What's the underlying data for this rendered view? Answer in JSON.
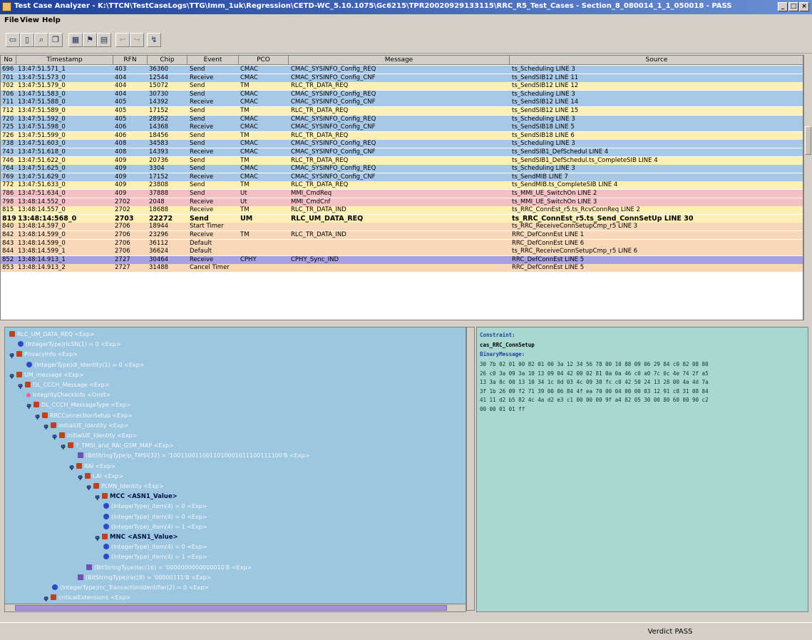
{
  "window": {
    "title": "Test Case Analyzer - K:\\TTCN\\TestCaseLogs\\TTG\\Imm_1uk\\Regression\\CETD-WC_5.10.1075\\Gc6215\\TPR20020929133115\\RRC_R5_Test_Cases - Section_8_080014_1_1_050018 - PASS"
  },
  "menu": [
    {
      "label": "File"
    },
    {
      "label": "View"
    },
    {
      "label": "Help"
    }
  ],
  "toolbar": [
    {
      "icon": "open-icon",
      "glyph": "▭"
    },
    {
      "icon": "new-icon",
      "glyph": "▯"
    },
    {
      "icon": "find-icon",
      "glyph": "⌕"
    },
    {
      "icon": "copy-icon",
      "glyph": "❐"
    },
    {
      "icon": "filter-icon",
      "glyph": "▦"
    },
    {
      "icon": "mark-icon",
      "glyph": "⚑"
    },
    {
      "icon": "step-icon",
      "glyph": "▤"
    },
    {
      "icon": "back-icon",
      "glyph": "↩"
    },
    {
      "icon": "forward-icon",
      "glyph": "↪"
    },
    {
      "icon": "run-icon",
      "glyph": "↯"
    }
  ],
  "grid": {
    "columns": [
      "No",
      "Timestamp",
      "RFN",
      "Chip",
      "Event",
      "PCO",
      "Message",
      "Source"
    ],
    "colors": {
      "blue": "#a8c8e8",
      "yellow": "#fcf0b4",
      "pink": "#f4c0c4",
      "orange": "#f8d8b8",
      "selected": "#a8a0e0"
    },
    "rows": [
      {
        "no": "696",
        "ts": "13:47:51.571_1",
        "rfn": "403",
        "chip": "36360",
        "event": "Send",
        "pco": "CMAC",
        "msg": "CMAC_SYSINFO_Config_REQ",
        "src": "ts_Scheduling LINE 3",
        "color": "blue"
      },
      {
        "no": "701",
        "ts": "13:47:51.573_0",
        "rfn": "404",
        "chip": "12544",
        "event": "Receive",
        "pco": "CMAC",
        "msg": "CMAC_SYSINFO_Config_CNF",
        "src": "ts_SendSIB12 LINE 11",
        "color": "blue"
      },
      {
        "no": "702",
        "ts": "13:47:51.579_0",
        "rfn": "404",
        "chip": "15072",
        "event": "Send",
        "pco": "TM",
        "msg": "RLC_TR_DATA_REQ",
        "src": "ts_SendSIB12 LINE 12",
        "color": "yellow"
      },
      {
        "no": "706",
        "ts": "13:47:51.583_0",
        "rfn": "404",
        "chip": "30730",
        "event": "Send",
        "pco": "CMAC",
        "msg": "CMAC_SYSINFO_Config_REQ",
        "src": "ts_Scheduling LINE 3",
        "color": "blue"
      },
      {
        "no": "711",
        "ts": "13:47:51.588_0",
        "rfn": "405",
        "chip": "14392",
        "event": "Receive",
        "pco": "CMAC",
        "msg": "CMAC_SYSINFO_Config_CNF",
        "src": "ts_SendSIB12 LINE 14",
        "color": "blue"
      },
      {
        "no": "712",
        "ts": "13:47:51.589_0",
        "rfn": "405",
        "chip": "17152",
        "event": "Send",
        "pco": "TM",
        "msg": "RLC_TR_DATA_REQ",
        "src": "ts_SendSIB12 LINE 15",
        "color": "yellow"
      },
      {
        "no": "720",
        "ts": "13:47:51.592_0",
        "rfn": "405",
        "chip": "28952",
        "event": "Send",
        "pco": "CMAC",
        "msg": "CMAC_SYSINFO_Config_REQ",
        "src": "ts_Scheduling LINE 3",
        "color": "blue"
      },
      {
        "no": "725",
        "ts": "13:47:51.598_0",
        "rfn": "406",
        "chip": "14368",
        "event": "Receive",
        "pco": "CMAC",
        "msg": "CMAC_SYSINFO_Config_CNF",
        "src": "ts_SendSIB18 LINE 5",
        "color": "blue"
      },
      {
        "no": "726",
        "ts": "13:47:51.599_0",
        "rfn": "406",
        "chip": "18456",
        "event": "Send",
        "pco": "TM",
        "msg": "RLC_TR_DATA_REQ",
        "src": "ts_SendSIB18 LINE 6",
        "color": "yellow"
      },
      {
        "no": "738",
        "ts": "13:47:51.603_0",
        "rfn": "408",
        "chip": "34583",
        "event": "Send",
        "pco": "CMAC",
        "msg": "CMAC_SYSINFO_Config_REQ",
        "src": "ts_Scheduling LINE 3",
        "color": "blue"
      },
      {
        "no": "743",
        "ts": "13:47:51.618_0",
        "rfn": "408",
        "chip": "14393",
        "event": "Receive",
        "pco": "CMAC",
        "msg": "CMAC_SYSINFO_Config_CNF",
        "src": "ts_SendSIB1_DefSchedul LINE 4",
        "color": "blue"
      },
      {
        "no": "746",
        "ts": "13:47:51.622_0",
        "rfn": "409",
        "chip": "20736",
        "event": "Send",
        "pco": "TM",
        "msg": "RLC_TR_DATA_REQ",
        "src": "ts_SendSIB1_DefSchedul.ts_CompleteSIB LINE 4",
        "color": "yellow"
      },
      {
        "no": "764",
        "ts": "13:47:51.625_0",
        "rfn": "409",
        "chip": "3304",
        "event": "Send",
        "pco": "CMAC",
        "msg": "CMAC_SYSINFO_Config_REQ",
        "src": "ts_Scheduling LINE 3",
        "color": "blue"
      },
      {
        "no": "769",
        "ts": "13:47:51.629_0",
        "rfn": "409",
        "chip": "17152",
        "event": "Receive",
        "pco": "CMAC",
        "msg": "CMAC_SYSINFO_Config_CNF",
        "src": "ts_SendMIB LINE 7",
        "color": "blue"
      },
      {
        "no": "772",
        "ts": "13:47:51.633_0",
        "rfn": "409",
        "chip": "23808",
        "event": "Send",
        "pco": "TM",
        "msg": "RLC_TR_DATA_REQ",
        "src": "ts_SendMIB.ts_CompleteSIB LINE 4",
        "color": "yellow"
      },
      {
        "no": "786",
        "ts": "13:47:51.634_0",
        "rfn": "409",
        "chip": "37888",
        "event": "Send",
        "pco": "Ut",
        "msg": "MMI_CmdReq",
        "src": "ts_MMI_UE_SwitchOn LINE 2",
        "color": "pink"
      },
      {
        "no": "798",
        "ts": "13:48:14.552_0",
        "rfn": "2702",
        "chip": "2048",
        "event": "Receive",
        "pco": "Ut",
        "msg": "MMI_CmdCnf",
        "src": "ts_MMI_UE_SwitchOn LINE 3",
        "color": "pink"
      },
      {
        "no": "815",
        "ts": "13:48:14.557_0",
        "rfn": "2702",
        "chip": "18688",
        "event": "Receive",
        "pco": "TM",
        "msg": "RLC_TR_DATA_IND",
        "src": "ts_RRC_ConnEst_r5.ts_RcvConnReq LINE 2",
        "color": "yellow"
      },
      {
        "no": "819",
        "ts": "13:48:14:568_0",
        "rfn": "2703",
        "chip": "22272",
        "event": "Send",
        "pco": "UM",
        "msg": "RLC_UM_DATA_REQ",
        "src": "ts_RRC_ConnEst_r5.ts_Send_ConnSetUp LINE 30",
        "color": "yellow",
        "hl": true
      },
      {
        "no": "840",
        "ts": "13:48:14.597_0",
        "rfn": "2706",
        "chip": "18944",
        "event": "Start Timer",
        "pco": "",
        "msg": "",
        "src": "ts_RRC_ReceiveConnSetupCmp_r5 LINE 3",
        "color": "orange"
      },
      {
        "no": "842",
        "ts": "13:48:14.599_0",
        "rfn": "2706",
        "chip": "23296",
        "event": "Receive",
        "pco": "TM",
        "msg": "RLC_TR_DATA_IND",
        "src": "RRC_DefConnEst LINE 1",
        "color": "orange"
      },
      {
        "no": "843",
        "ts": "13:48:14.599_0",
        "rfn": "2706",
        "chip": "36112",
        "event": "Default",
        "pco": "",
        "msg": "",
        "src": "RRC_DefConnEst LINE 6",
        "color": "orange"
      },
      {
        "no": "844",
        "ts": "13:48:14.599_1",
        "rfn": "2706",
        "chip": "36624",
        "event": "Default",
        "pco": "",
        "msg": "",
        "src": "ts_RRC_ReceiveConnSetupCmp_r5 LINE 6",
        "color": "orange"
      },
      {
        "no": "852",
        "ts": "13:48:14.913_1",
        "rfn": "2727",
        "chip": "30464",
        "event": "Receive",
        "pco": "CPHY",
        "msg": "CPHY_Sync_IND",
        "src": "RRC_DefConnEst LINE 5",
        "color": "selected"
      },
      {
        "no": "853",
        "ts": "13:48:14.913_2",
        "rfn": "2727",
        "chip": "31488",
        "event": "Cancel Timer",
        "pco": "",
        "msg": "",
        "src": "RRC_DefConnEst LINE 5",
        "color": "orange"
      }
    ]
  },
  "tree": [
    {
      "indent": 0,
      "exp": "",
      "icon": "node",
      "text": "RLC_UM_DATA_REQ <Exp>"
    },
    {
      "indent": 1,
      "exp": "",
      "icon": "leaf",
      "text": "(IntegerType)rlcSN(1) = 0 <Exp>"
    },
    {
      "indent": 0,
      "exp": "φ",
      "icon": "node",
      "text": "PrivacyInfo <Exp>"
    },
    {
      "indent": 2,
      "exp": "",
      "icon": "leaf",
      "text": "(IntegerType)dl_Identity(1) = 0 <Exp>"
    },
    {
      "indent": 0,
      "exp": "φ",
      "icon": "node",
      "text": "UM_message <Exp>"
    },
    {
      "indent": 1,
      "exp": "φ",
      "icon": "node",
      "text": "DL_CCCH_Message <Exp>"
    },
    {
      "indent": 2,
      "exp": "",
      "icon": "pink",
      "text": "IntegrityCheckInfo <Omit>"
    },
    {
      "indent": 2,
      "exp": "φ",
      "icon": "node",
      "text": "DL_CCCH_MessageType <Exp>"
    },
    {
      "indent": 3,
      "exp": "φ",
      "icon": "node",
      "text": "RRCConnectionSetup <Exp>"
    },
    {
      "indent": 4,
      "exp": "φ",
      "icon": "node",
      "text": "initialUE_Identity <Exp>"
    },
    {
      "indent": 5,
      "exp": "φ",
      "icon": "node",
      "text": "initialUE_Identity <Exp>"
    },
    {
      "indent": 6,
      "exp": "φ",
      "icon": "node",
      "text": "?_TMSI_and_RAI_GSM_MAP <Exp>"
    },
    {
      "indent": 8,
      "exp": "",
      "icon": "param",
      "text": "(BitStringType)p_TMSI(32) = '1001100110011010001011100111100'B <Exp>"
    },
    {
      "indent": 7,
      "exp": "φ",
      "icon": "node",
      "text": "RAI <Exp>"
    },
    {
      "indent": 8,
      "exp": "φ",
      "icon": "node",
      "text": "LAI <Exp>"
    },
    {
      "indent": 9,
      "exp": "φ",
      "icon": "node",
      "text": "PLMN_Identity <Exp>"
    },
    {
      "indent": 10,
      "exp": "φ",
      "icon": "node",
      "text": "MCC <ASN1_Value>",
      "bold": true
    },
    {
      "indent": 11,
      "exp": "",
      "icon": "leaf",
      "text": "(IntegerType)_item(4) = 0 <Exp>"
    },
    {
      "indent": 11,
      "exp": "",
      "icon": "leaf",
      "text": "(IntegerType)_item(4) = 0 <Exp>"
    },
    {
      "indent": 11,
      "exp": "",
      "icon": "leaf",
      "text": "(IntegerType)_item(4) = 1 <Exp>"
    },
    {
      "indent": 10,
      "exp": "φ",
      "icon": "node",
      "text": "MNC <ASN1_Value>",
      "bold": true
    },
    {
      "indent": 11,
      "exp": "",
      "icon": "leaf",
      "text": "(IntegerType)_item(4) = 0 <Exp>"
    },
    {
      "indent": 11,
      "exp": "",
      "icon": "leaf",
      "text": "(IntegerType)_item(4) = 1 <Exp>"
    },
    {
      "indent": 9,
      "exp": "",
      "icon": "param",
      "text": "(BitStringType)lac(16) = '0000000000000010'B <Exp>"
    },
    {
      "indent": 8,
      "exp": "",
      "icon": "param",
      "text": "(BitStringType)rac(8) = '00000111'B <Exp>"
    },
    {
      "indent": 5,
      "exp": "",
      "icon": "leaf",
      "text": "(IntegerType)rrc_TransactionIdentifier(2) = 0 <Exp>"
    },
    {
      "indent": 4,
      "exp": "φ",
      "icon": "node",
      "text": "criticalExtensions <Exp>"
    }
  ],
  "detail": {
    "constraint_label": "Constraint:",
    "constraint_value": "cas_RRC_ConnSetup",
    "binary_label": "BinaryMessage:",
    "hex": [
      "30 7b 02 01 00 82 01 00 3a 12 34 56 78 00 10 88 09 06 29 84 c0 82 08 80",
      "26 c0 3a 09 3a 10 13 09 04 42 00 02 81 0a 0a 46 c0 a0 7c 0c 4e 74 2f a5",
      "13 3a 8c 00 13 10 34 1c 0d 03 4c 09 30 fc c0 42 50 24 13 28 00 4a 4d 7a",
      "3f 1b 26 09 f2 71 39 00 06 84 4f ea 70 00 04 00 00 03 12 91 c8 31 08 84",
      "41 11 d2 b5 82 4c 4a d2 e3 c1 00 00 00 9f a4 82 05 30 00 80 60 00 90 c2",
      "00 00 01 01 ff"
    ]
  },
  "status": {
    "verdict": "Verdict PASS"
  }
}
